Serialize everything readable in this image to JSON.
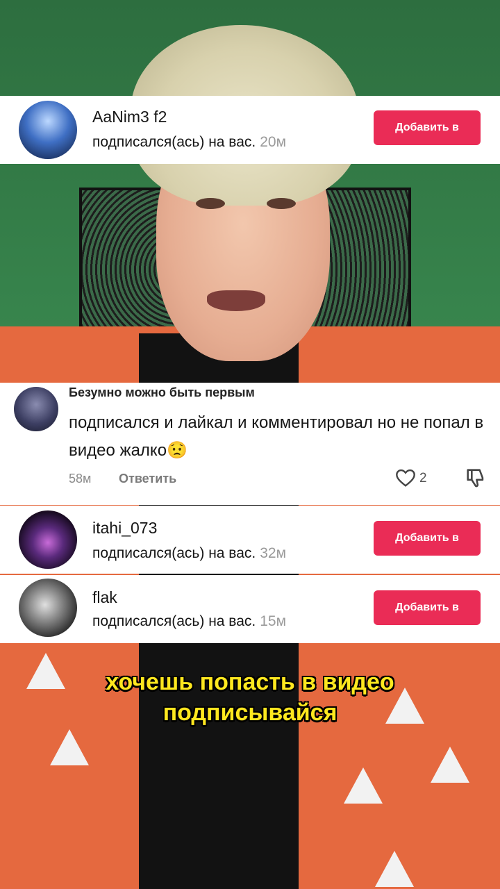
{
  "notifications": [
    {
      "username": "AaNim3 f2",
      "action": "подписался(ась) на вас.",
      "time": "20м",
      "button": "Добавить в"
    },
    {
      "username": "itahi_073",
      "action": "подписался(ась) на вас.",
      "time": "32м",
      "button": "Добавить в"
    },
    {
      "username": "flak",
      "action": "подписался(ась) на вас.",
      "time": "15м",
      "button": "Добавить в"
    }
  ],
  "comment": {
    "author": "Безумно можно быть первым",
    "text": "подписался и лайкал и комментировал но не попал в видео жалко😟",
    "time": "58м",
    "reply_label": "Ответить",
    "like_count": "2"
  },
  "caption": {
    "line1": "хочешь попасть в видео",
    "line2": "подписывайся"
  },
  "colors": {
    "accent_button": "#ea2c56",
    "caption_text": "#ffe81f"
  }
}
